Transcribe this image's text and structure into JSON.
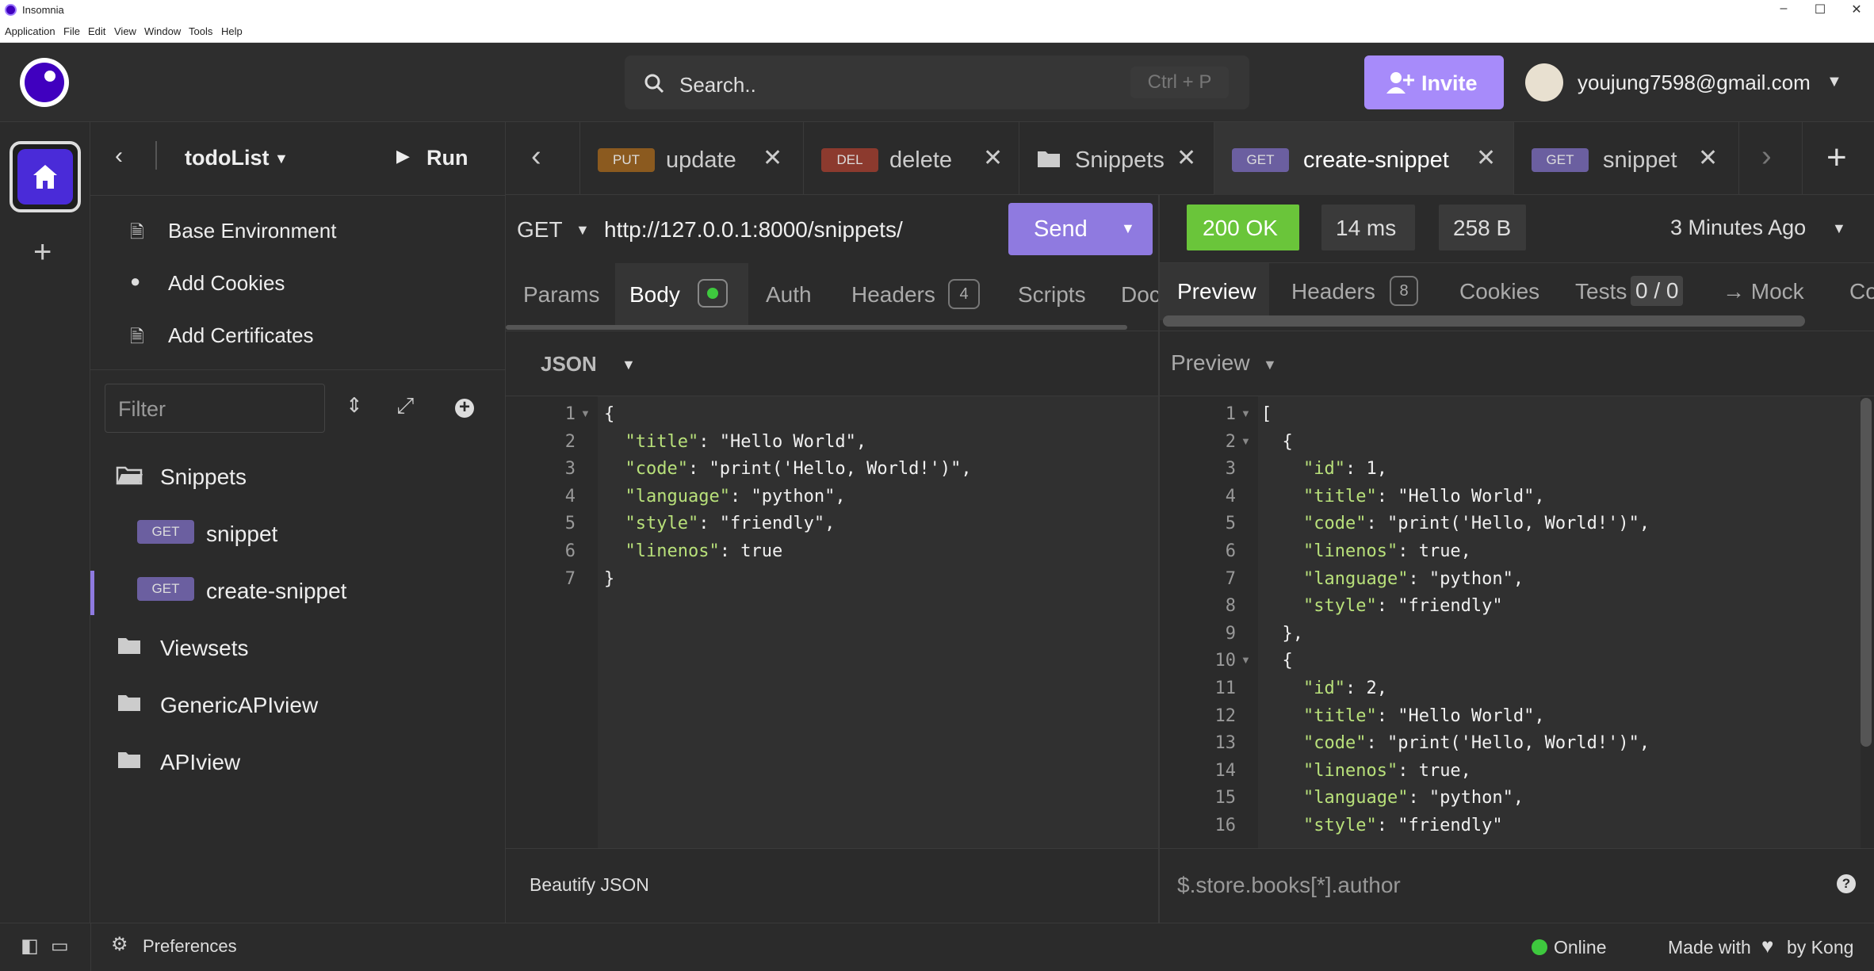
{
  "window": {
    "title": "Insomnia",
    "menu": [
      "Application",
      "File",
      "Edit",
      "View",
      "Window",
      "Tools",
      "Help"
    ]
  },
  "header": {
    "search_placeholder": "Search..",
    "search_shortcut": "Ctrl + P",
    "invite_label": "Invite",
    "user_email": "youjung7598@gmail.com"
  },
  "sidebar": {
    "project_name": "todoList",
    "run_label": "Run",
    "actions": [
      "Base Environment",
      "Add Cookies",
      "Add Certificates"
    ],
    "filter_placeholder": "Filter",
    "tree": [
      {
        "type": "folder",
        "label": "Snippets",
        "open": true
      },
      {
        "type": "request",
        "method": "GET",
        "label": "snippet"
      },
      {
        "type": "request",
        "method": "GET",
        "label": "create-snippet",
        "active": true
      },
      {
        "type": "folder",
        "label": "Viewsets"
      },
      {
        "type": "folder",
        "label": "GenericAPIview"
      },
      {
        "type": "folder",
        "label": "APIview"
      }
    ]
  },
  "tabs": [
    {
      "method": "PUT",
      "label": "update"
    },
    {
      "method": "DEL",
      "label": "delete"
    },
    {
      "method": "",
      "label": "Snippets"
    },
    {
      "method": "GET",
      "label": "create-snippet",
      "active": true
    },
    {
      "method": "GET",
      "label": "snippet"
    }
  ],
  "request": {
    "method": "GET",
    "url": "http://127.0.0.1:8000/snippets/",
    "send_label": "Send",
    "subtabs": [
      "Params",
      "Body",
      "Auth",
      "Headers",
      "Scripts",
      "Doc"
    ],
    "headers_count": "4",
    "body_format": "JSON",
    "body_lines": [
      "{",
      "  \"title\": \"Hello World\",",
      "  \"code\": \"print('Hello, World!')\",",
      "  \"language\": \"python\",",
      "  \"style\": \"friendly\",",
      "  \"linenos\": true",
      "}"
    ],
    "beautify_label": "Beautify JSON"
  },
  "response": {
    "status": "200 OK",
    "time": "14 ms",
    "size": "258 B",
    "age": "3 Minutes Ago",
    "subtabs": [
      "Preview",
      "Headers",
      "Cookies",
      "Tests",
      "→ Mock",
      "Co"
    ],
    "headers_count": "8",
    "tests_count": "0 / 0",
    "preview_mode": "Preview",
    "status_color": "#6ac53a",
    "body_lines": [
      "[",
      "  {",
      "    \"id\": 1,",
      "    \"title\": \"Hello World\",",
      "    \"code\": \"print('Hello, World!')\",",
      "    \"linenos\": true,",
      "    \"language\": \"python\",",
      "    \"style\": \"friendly\"",
      "  },",
      "  {",
      "    \"id\": 2,",
      "    \"title\": \"Hello World\",",
      "    \"code\": \"print('Hello, World!')\",",
      "    \"linenos\": true,",
      "    \"language\": \"python\",",
      "    \"style\": \"friendly\""
    ],
    "filter_placeholder": "$.store.books[*].author"
  },
  "statusbar": {
    "preferences": "Preferences",
    "online": "Online",
    "made_with": "Made with",
    "by": "by Kong"
  },
  "colors": {
    "accent": "#a78bfa",
    "send": "#8f7ae0",
    "online": "#3ec93e"
  }
}
